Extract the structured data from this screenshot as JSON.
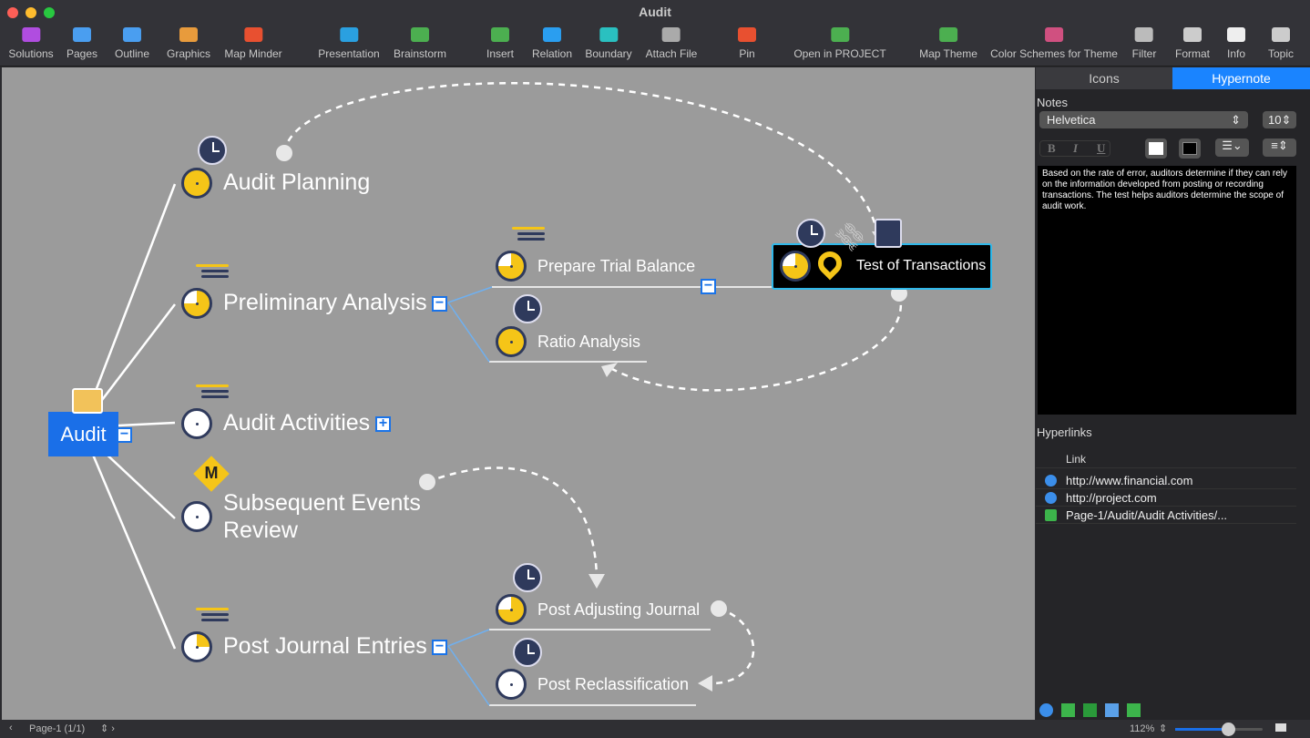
{
  "window": {
    "title": "Audit"
  },
  "toolbar": [
    {
      "label": "Solutions",
      "icon": "solutions-icon",
      "color": "#b04de0"
    },
    {
      "label": "Pages",
      "icon": "pages-icon",
      "color": "#4a9ef0"
    },
    {
      "label": "Outline",
      "icon": "outline-icon",
      "color": "#4a9ef0"
    },
    {
      "label": "Graphics",
      "icon": "graphics-icon",
      "color": "#e89b3c"
    },
    {
      "label": "Map Minder",
      "icon": "map-minder-icon",
      "color": "#e85030"
    },
    {
      "label": "Presentation",
      "icon": "presentation-icon",
      "color": "#2aa0e0"
    },
    {
      "label": "Brainstorm",
      "icon": "brainstorm-icon",
      "color": "#4caf50"
    },
    {
      "label": "Insert",
      "icon": "insert-icon",
      "color": "#4caf50"
    },
    {
      "label": "Relation",
      "icon": "relation-icon",
      "color": "#2a9ef0"
    },
    {
      "label": "Boundary",
      "icon": "boundary-icon",
      "color": "#2ac0c0"
    },
    {
      "label": "Attach File",
      "icon": "attach-icon",
      "color": "#aaa"
    },
    {
      "label": "Pin",
      "icon": "pin-icon",
      "color": "#e85030"
    },
    {
      "label": "Open in PROJECT",
      "icon": "project-icon",
      "color": "#4caf50"
    },
    {
      "label": "Map Theme",
      "icon": "map-theme-icon",
      "color": "#4caf50"
    },
    {
      "label": "Color Schemes for Theme",
      "icon": "color-scheme-icon",
      "color": "#d05080"
    },
    {
      "label": "Filter",
      "icon": "filter-icon",
      "color": "#bbb"
    },
    {
      "label": "Format",
      "icon": "format-icon",
      "color": "#ccc"
    },
    {
      "label": "Info",
      "icon": "info-icon",
      "color": "#eee"
    },
    {
      "label": "Topic",
      "icon": "topic-icon",
      "color": "#ccc"
    }
  ],
  "map": {
    "root": "Audit",
    "topics": {
      "audit_planning": {
        "label": "Audit Planning",
        "progress": 1.0
      },
      "preliminary_analysis": {
        "label": "Preliminary Analysis",
        "progress": 0.75
      },
      "audit_activities": {
        "label": "Audit Activities",
        "progress": 0
      },
      "subsequent_events": {
        "label": "Subsequent Events",
        "label2": "Review",
        "progress": 0,
        "marker": "M"
      },
      "post_journal": {
        "label": "Post Journal Entries",
        "progress": 0.25
      },
      "prepare_trial": {
        "label": "Prepare Trial Balance",
        "progress": 0.75
      },
      "ratio": {
        "label": "Ratio Analysis",
        "progress": 1.0
      },
      "test_transactions": {
        "label": "Test of Transactions",
        "progress": 0.75
      },
      "post_adjusting": {
        "label": "Post Adjusting Journal",
        "progress": 0.75
      },
      "post_reclass": {
        "label": "Post Reclassification",
        "progress": 0
      }
    }
  },
  "panel": {
    "tabs": [
      "Icons",
      "Hypernote"
    ],
    "notes_label": "Notes",
    "font": "Helvetica",
    "font_size": "10",
    "format_bold": "B",
    "format_italic": "I",
    "format_underline": "U",
    "note_text": "Based on the rate of error, auditors determine if they can rely on the information developed from posting or recording transactions. The test helps auditors determine the scope of audit work.",
    "hyperlinks_label": "Hyperlinks",
    "link_col": "Link",
    "links": [
      "http://www.financial.com",
      "http://project.com",
      "Page-1/Audit/Audit Activities/..."
    ]
  },
  "status": {
    "page": "Page-1 (1/1)",
    "zoom": "112%",
    "zoom_fraction": 0.6
  }
}
